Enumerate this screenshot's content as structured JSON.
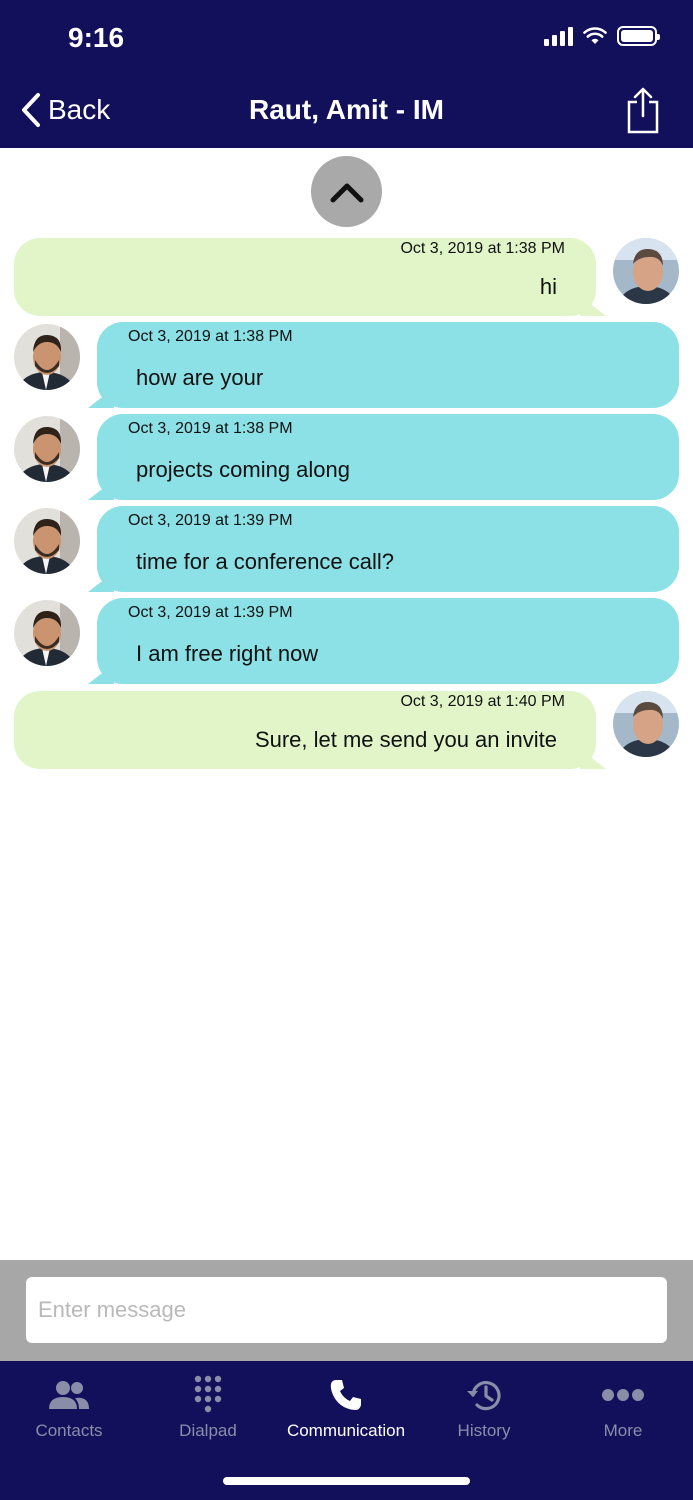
{
  "status_bar": {
    "time": "9:16"
  },
  "nav": {
    "back_label": "Back",
    "title": "Raut, Amit - IM"
  },
  "messages": [
    {
      "direction": "outgoing",
      "timestamp": "Oct 3, 2019 at 1:38 PM",
      "text": "hi"
    },
    {
      "direction": "incoming",
      "timestamp": "Oct 3, 2019 at 1:38 PM",
      "text": "how are your"
    },
    {
      "direction": "incoming",
      "timestamp": "Oct 3, 2019 at 1:38 PM",
      "text": "projects coming along"
    },
    {
      "direction": "incoming",
      "timestamp": "Oct 3, 2019 at 1:39 PM",
      "text": "time for a conference call?"
    },
    {
      "direction": "incoming",
      "timestamp": "Oct 3, 2019 at 1:39 PM",
      "text": "I am free right now"
    },
    {
      "direction": "outgoing",
      "timestamp": "Oct 3, 2019 at 1:40 PM",
      "text": "Sure, let me send you an invite"
    }
  ],
  "composer": {
    "placeholder": "Enter message",
    "value": ""
  },
  "tabs": [
    {
      "label": "Contacts",
      "icon": "contacts-icon",
      "active": false
    },
    {
      "label": "Dialpad",
      "icon": "dialpad-icon",
      "active": false
    },
    {
      "label": "Communication",
      "icon": "phone-icon",
      "active": true
    },
    {
      "label": "History",
      "icon": "history-icon",
      "active": false
    },
    {
      "label": "More",
      "icon": "more-icon",
      "active": false
    }
  ],
  "colors": {
    "header_bg": "#12105a",
    "outgoing_bubble": "#e1f5c8",
    "incoming_bubble": "#8ce1e6",
    "composer_bg": "#a7a7a7",
    "tab_inactive": "#8a8da8",
    "tab_active": "#ffffff"
  }
}
